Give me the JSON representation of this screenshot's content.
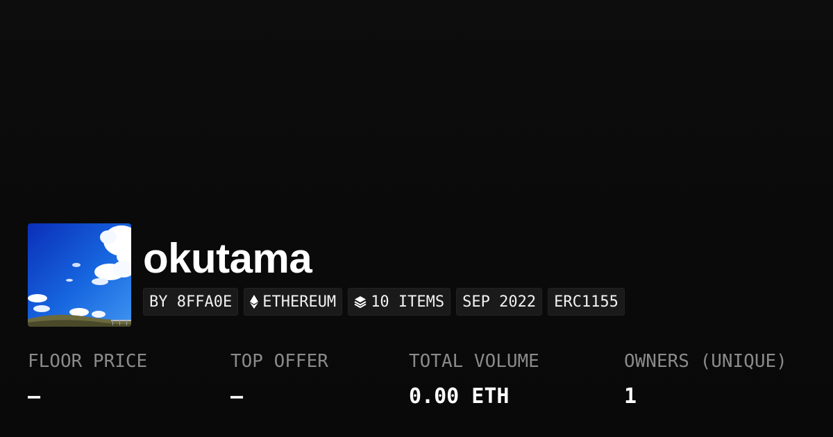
{
  "collection": {
    "name": "okutama",
    "avatar_icon": "sky-clouds-photo"
  },
  "tags": {
    "creator": "BY 8FFA0E",
    "chain": "ETHEREUM",
    "chain_icon": "ethereum-icon",
    "items": "10 ITEMS",
    "items_icon": "layers-icon",
    "date": "SEP 2022",
    "standard": "ERC1155"
  },
  "stats": {
    "floor_price_label": "FLOOR PRICE",
    "floor_price_value": "–",
    "top_offer_label": "TOP OFFER",
    "top_offer_value": "–",
    "total_volume_label": "TOTAL VOLUME",
    "total_volume_value": "0.00 ETH",
    "owners_label": "OWNERS (UNIQUE)",
    "owners_value": "1"
  },
  "colors": {
    "background": "#0a0a0a",
    "tag_background": "#1a1a1a",
    "label": "#8a8a8a",
    "value": "#ffffff"
  }
}
